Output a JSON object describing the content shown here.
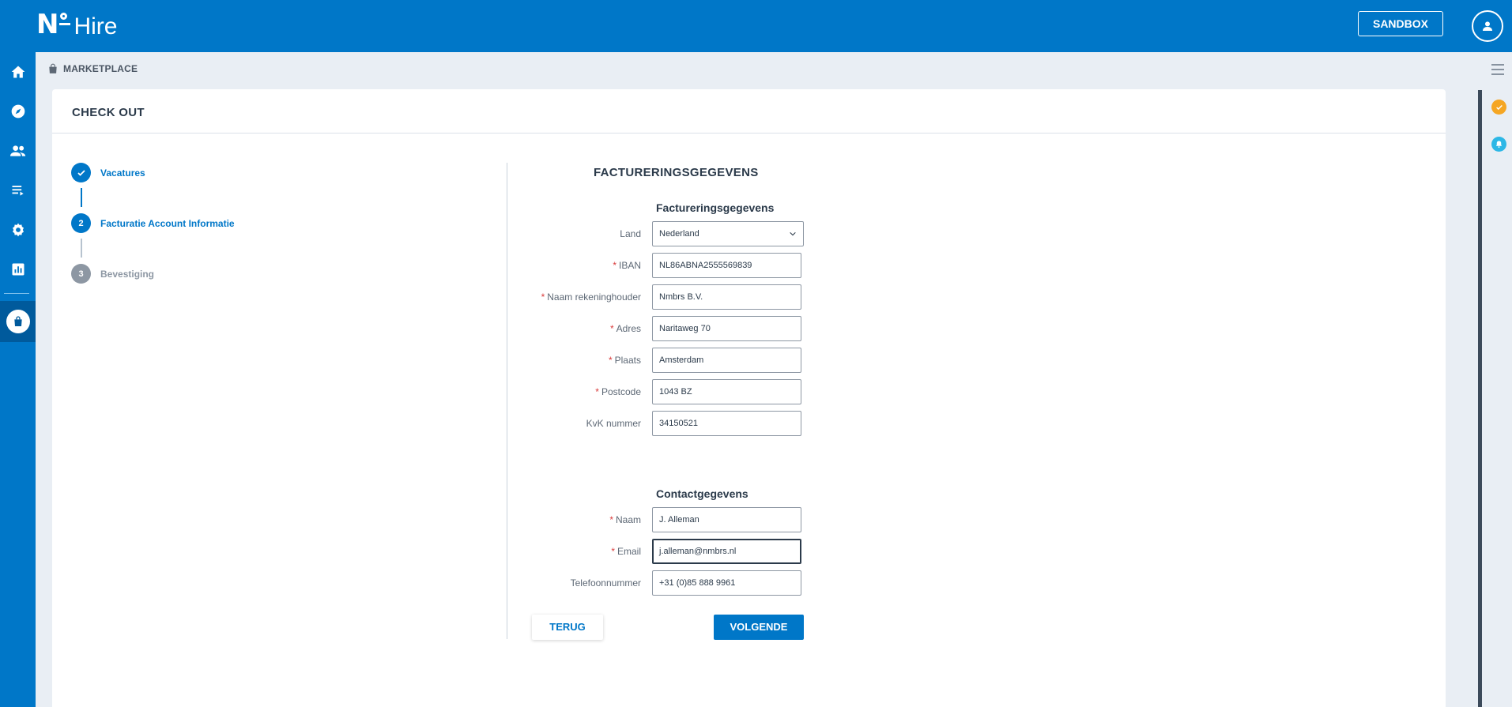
{
  "app": {
    "logo_mark": "N",
    "logo_text": "Hire",
    "env_label": "SANDBOX"
  },
  "icons": {
    "user": "user-icon",
    "nav": [
      "home-icon",
      "compass-icon",
      "people-icon",
      "list-icon",
      "gear-icon",
      "chart-icon",
      "shopping-bag-icon"
    ],
    "breadcrumb": "shopping-bag-icon",
    "right_rail": [
      "menu-icon",
      "check-badge-icon",
      "bell-icon"
    ]
  },
  "colors": {
    "brand": "#0077c8",
    "nav_active": "#005a9c",
    "required": "#d93b3b",
    "warning": "#f5a623",
    "info": "#2db7e6",
    "muted_step": "#8d97a3"
  },
  "breadcrumb": {
    "label": "MARKETPLACE"
  },
  "page": {
    "title": "CHECK OUT"
  },
  "stepper": {
    "steps": [
      {
        "number": "✔",
        "label": "Vacatures",
        "state": "done"
      },
      {
        "number": "2",
        "label": "Facturatie Account Informatie",
        "state": "active"
      },
      {
        "number": "3",
        "label": "Bevestiging",
        "state": "pending"
      }
    ]
  },
  "form": {
    "heading": "FACTURERINGSGEGEVENS",
    "billing": {
      "title": "Factureringsgegevens",
      "country": {
        "label": "Land",
        "value": "Nederland"
      },
      "iban": {
        "label": "IBAN",
        "value": "NL86ABNA2555569839",
        "required": "*"
      },
      "account_holder": {
        "label": "Naam rekeninghouder",
        "value": "Nmbrs B.V.",
        "required": "*"
      },
      "address": {
        "label": "Adres",
        "value": "Naritaweg 70",
        "required": "*"
      },
      "city": {
        "label": "Plaats",
        "value": "Amsterdam",
        "required": "*"
      },
      "postcode": {
        "label": "Postcode",
        "value": "1043 BZ",
        "required": "*"
      },
      "kvk": {
        "label": "KvK nummer",
        "value": "34150521"
      }
    },
    "contact": {
      "title": "Contactgegevens",
      "name": {
        "label": "Naam",
        "value": "J. Alleman",
        "required": "*"
      },
      "email": {
        "label": "Email",
        "value": "j.alleman@nmbrs.nl",
        "required": "*"
      },
      "phone": {
        "label": "Telefoonnummer",
        "value": "+31 (0)85 888 9961"
      }
    },
    "buttons": {
      "back": "TERUG",
      "next": "VOLGENDE"
    }
  }
}
